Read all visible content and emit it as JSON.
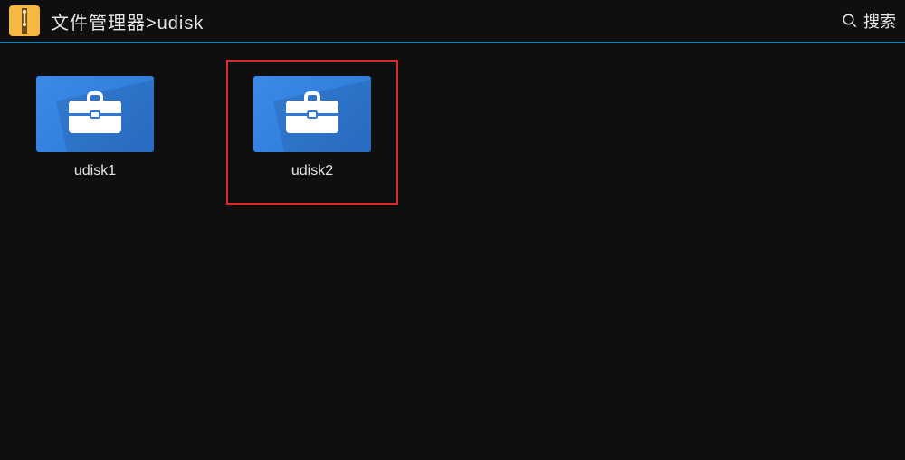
{
  "header": {
    "breadcrumb": "文件管理器>udisk",
    "search_label": "搜索"
  },
  "items": [
    {
      "label": "udisk1",
      "selected": false
    },
    {
      "label": "udisk2",
      "selected": true
    }
  ]
}
